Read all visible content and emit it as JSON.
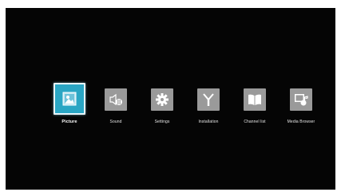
{
  "screen": {
    "background": "#050505",
    "accent": "#2aa6c4",
    "tile_color": "#9a9a9a"
  },
  "menu": {
    "items": [
      {
        "label": "Picture",
        "icon": "picture-icon",
        "selected": true
      },
      {
        "label": "Sound",
        "icon": "speaker-icon",
        "selected": false
      },
      {
        "label": "Settings",
        "icon": "gear-icon",
        "selected": false
      },
      {
        "label": "Installation",
        "icon": "antenna-icon",
        "selected": false
      },
      {
        "label": "Channel list",
        "icon": "book-icon",
        "selected": false
      },
      {
        "label": "Media Browser",
        "icon": "media-browser-icon",
        "selected": false
      }
    ]
  }
}
